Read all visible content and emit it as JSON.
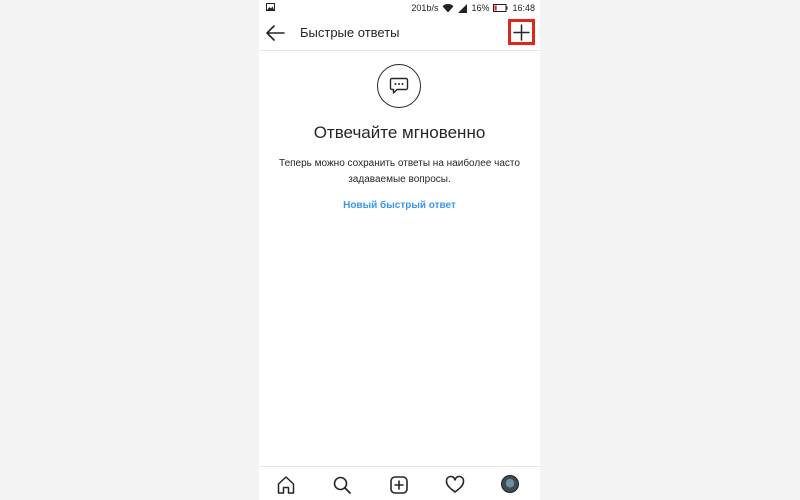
{
  "status_bar": {
    "speed": "201b/s",
    "battery": "16%",
    "time": "16:48"
  },
  "header": {
    "title": "Быстрые ответы"
  },
  "empty_state": {
    "heading": "Отвечайте мгновенно",
    "description": "Теперь можно сохранить ответы на наиболее часто задаваемые вопросы.",
    "link": "Новый быстрый ответ"
  },
  "colors": {
    "accent_link": "#3897f0",
    "highlight_box": "#e0261b",
    "text": "#262626"
  },
  "icons": {
    "back": "arrow-left-icon",
    "add": "plus-icon",
    "empty_state": "chat-bubble-icon",
    "nav": [
      "home-icon",
      "search-icon",
      "add-post-icon",
      "heart-icon",
      "profile-avatar"
    ]
  }
}
